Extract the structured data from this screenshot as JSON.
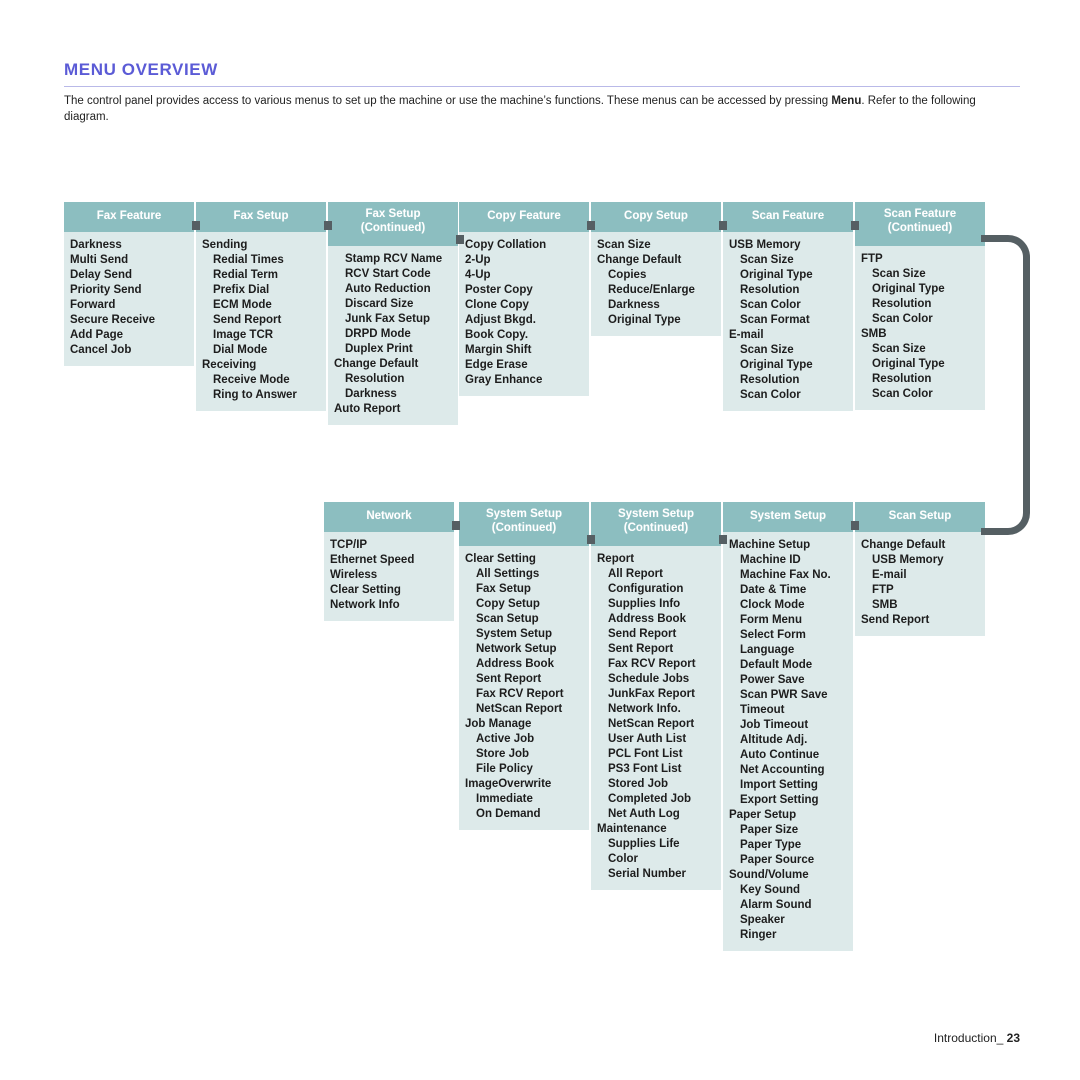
{
  "header": {
    "title": "MENU OVERVIEW",
    "intro_part1": "The control panel provides access to various menus to set up the machine or use the machine’s functions. These menus can be accessed by pressing ",
    "intro_bold": "Menu",
    "intro_part2": ". Refer to the following diagram."
  },
  "colors": {
    "title": "#5b5bd6",
    "node_header_bg": "#8cbec0",
    "node_body_bg": "#ddeaea",
    "connector": "#555f63",
    "text": "#1d1d1d"
  },
  "footer": {
    "label": "Introduction_",
    "page": "23"
  },
  "diagram": {
    "row1": [
      {
        "title": "Fax Feature",
        "subtitle": "",
        "align": "left",
        "items": [
          {
            "label": "Darkness",
            "level": 1
          },
          {
            "label": "Multi Send",
            "level": 1
          },
          {
            "label": "Delay Send",
            "level": 1
          },
          {
            "label": "Priority Send",
            "level": 1
          },
          {
            "label": "Forward",
            "level": 1
          },
          {
            "label": "Secure Receive",
            "level": 1
          },
          {
            "label": "Add Page",
            "level": 1
          },
          {
            "label": "Cancel Job",
            "level": 1
          }
        ]
      },
      {
        "title": "Fax Setup",
        "subtitle": "",
        "align": "left",
        "items": [
          {
            "label": "Sending",
            "level": 1
          },
          {
            "label": "Redial Times",
            "level": 2
          },
          {
            "label": "Redial Term",
            "level": 2
          },
          {
            "label": "Prefix Dial",
            "level": 2
          },
          {
            "label": "ECM Mode",
            "level": 2
          },
          {
            "label": "Send Report",
            "level": 2
          },
          {
            "label": "Image TCR",
            "level": 2
          },
          {
            "label": "Dial Mode",
            "level": 2
          },
          {
            "label": "Receiving",
            "level": 1
          },
          {
            "label": "Receive Mode",
            "level": 2
          },
          {
            "label": "Ring to Answer",
            "level": 2
          }
        ]
      },
      {
        "title": "Fax Setup",
        "subtitle": "(Continued)",
        "align": "right",
        "items": [
          {
            "label": "Stamp RCV Name",
            "level": 2
          },
          {
            "label": "RCV Start Code",
            "level": 2
          },
          {
            "label": "Auto Reduction",
            "level": 2
          },
          {
            "label": "Discard Size",
            "level": 2
          },
          {
            "label": "Junk Fax Setup",
            "level": 2
          },
          {
            "label": "DRPD Mode",
            "level": 2
          },
          {
            "label": "Duplex Print",
            "level": 2
          },
          {
            "label": "Change Default",
            "level": 1
          },
          {
            "label": "Resolution",
            "level": 2
          },
          {
            "label": "Darkness",
            "level": 2
          },
          {
            "label": "Auto Report",
            "level": 1
          }
        ]
      },
      {
        "title": "Copy Feature",
        "subtitle": "",
        "align": "left",
        "items": [
          {
            "label": "Copy Collation",
            "level": 1
          },
          {
            "label": "2-Up",
            "level": 1
          },
          {
            "label": "4-Up",
            "level": 1
          },
          {
            "label": "Poster Copy",
            "level": 1
          },
          {
            "label": "Clone Copy",
            "level": 1
          },
          {
            "label": "Adjust Bkgd.",
            "level": 1
          },
          {
            "label": "Book Copy.",
            "level": 1
          },
          {
            "label": "Margin Shift",
            "level": 1
          },
          {
            "label": "Edge Erase",
            "level": 1
          },
          {
            "label": "Gray Enhance",
            "level": 1
          }
        ]
      },
      {
        "title": "Copy Setup",
        "subtitle": "",
        "align": "left",
        "items": [
          {
            "label": "Scan Size",
            "level": 1
          },
          {
            "label": "Change Default",
            "level": 1
          },
          {
            "label": "Copies",
            "level": 2
          },
          {
            "label": "Reduce/Enlarge",
            "level": 2
          },
          {
            "label": "Darkness",
            "level": 2
          },
          {
            "label": "Original Type",
            "level": 2
          }
        ]
      },
      {
        "title": "Scan Feature",
        "subtitle": "",
        "align": "left",
        "items": [
          {
            "label": "USB Memory",
            "level": 1
          },
          {
            "label": "Scan Size",
            "level": 2
          },
          {
            "label": "Original Type",
            "level": 2
          },
          {
            "label": "Resolution",
            "level": 2
          },
          {
            "label": "Scan Color",
            "level": 2
          },
          {
            "label": "Scan Format",
            "level": 2
          },
          {
            "label": "E-mail",
            "level": 1
          },
          {
            "label": "Scan Size",
            "level": 2
          },
          {
            "label": "Original Type",
            "level": 2
          },
          {
            "label": "Resolution",
            "level": 2
          },
          {
            "label": "Scan Color",
            "level": 2
          }
        ]
      },
      {
        "title": "Scan Feature",
        "subtitle": "(Continued)",
        "align": "left",
        "items": [
          {
            "label": "FTP",
            "level": 1
          },
          {
            "label": "Scan Size",
            "level": 2
          },
          {
            "label": "Original Type",
            "level": 2
          },
          {
            "label": "Resolution",
            "level": 2
          },
          {
            "label": "Scan Color",
            "level": 2
          },
          {
            "label": "SMB",
            "level": 1
          },
          {
            "label": "Scan Size",
            "level": 2
          },
          {
            "label": "Original Type",
            "level": 2
          },
          {
            "label": "Resolution",
            "level": 2
          },
          {
            "label": "Scan Color",
            "level": 2
          }
        ]
      }
    ],
    "row2": [
      {
        "title": "Network",
        "subtitle": "",
        "align": "left",
        "items": [
          {
            "label": "TCP/IP",
            "level": 1
          },
          {
            "label": "Ethernet Speed",
            "level": 1
          },
          {
            "label": "Wireless",
            "level": 1
          },
          {
            "label": "Clear Setting",
            "level": 1
          },
          {
            "label": "Network Info",
            "level": 1
          }
        ]
      },
      {
        "title": "System Setup",
        "subtitle": "(Continued)",
        "align": "left",
        "items": [
          {
            "label": "Clear Setting",
            "level": 1
          },
          {
            "label": "All Settings",
            "level": 2
          },
          {
            "label": "Fax Setup",
            "level": 2
          },
          {
            "label": "Copy Setup",
            "level": 2
          },
          {
            "label": "Scan Setup",
            "level": 2
          },
          {
            "label": "System Setup",
            "level": 2
          },
          {
            "label": "Network Setup",
            "level": 2
          },
          {
            "label": "Address Book",
            "level": 2
          },
          {
            "label": "Sent Report",
            "level": 2
          },
          {
            "label": "Fax RCV Report",
            "level": 2
          },
          {
            "label": "NetScan Report",
            "level": 2
          },
          {
            "label": "Job Manage",
            "level": 1
          },
          {
            "label": "Active Job",
            "level": 2
          },
          {
            "label": "Store Job",
            "level": 2
          },
          {
            "label": "File Policy",
            "level": 2
          },
          {
            "label": "ImageOverwrite",
            "level": 1
          },
          {
            "label": "Immediate",
            "level": 2
          },
          {
            "label": "On Demand",
            "level": 2
          }
        ]
      },
      {
        "title": "System Setup",
        "subtitle": "(Continued)",
        "align": "left",
        "items": [
          {
            "label": "Report",
            "level": 1
          },
          {
            "label": "All Report",
            "level": 2
          },
          {
            "label": "Configuration",
            "level": 2
          },
          {
            "label": "Supplies Info",
            "level": 2
          },
          {
            "label": "Address Book",
            "level": 2
          },
          {
            "label": "Send Report",
            "level": 2
          },
          {
            "label": "Sent Report",
            "level": 2
          },
          {
            "label": "Fax RCV Report",
            "level": 2
          },
          {
            "label": "Schedule Jobs",
            "level": 2
          },
          {
            "label": "JunkFax Report",
            "level": 2
          },
          {
            "label": "Network Info.",
            "level": 2
          },
          {
            "label": "NetScan Report",
            "level": 2
          },
          {
            "label": "User Auth List",
            "level": 2
          },
          {
            "label": "PCL Font List",
            "level": 2
          },
          {
            "label": "PS3 Font List",
            "level": 2
          },
          {
            "label": "Stored Job",
            "level": 2
          },
          {
            "label": "Completed Job",
            "level": 2
          },
          {
            "label": "Net Auth Log",
            "level": 2
          },
          {
            "label": "Maintenance",
            "level": 1
          },
          {
            "label": "Supplies Life",
            "level": 2
          },
          {
            "label": "Color",
            "level": 2
          },
          {
            "label": "Serial Number",
            "level": 2
          }
        ]
      },
      {
        "title": "System Setup",
        "subtitle": "",
        "align": "left",
        "items": [
          {
            "label": "Machine Setup",
            "level": 1
          },
          {
            "label": "Machine ID",
            "level": 2
          },
          {
            "label": "Machine Fax No.",
            "level": 2
          },
          {
            "label": "Date & Time",
            "level": 2
          },
          {
            "label": "Clock Mode",
            "level": 2
          },
          {
            "label": "Form Menu",
            "level": 2
          },
          {
            "label": "Select Form",
            "level": 2
          },
          {
            "label": "Language",
            "level": 2
          },
          {
            "label": "Default Mode",
            "level": 2
          },
          {
            "label": "Power Save",
            "level": 2
          },
          {
            "label": "Scan PWR Save",
            "level": 2
          },
          {
            "label": "Timeout",
            "level": 2
          },
          {
            "label": "Job Timeout",
            "level": 2
          },
          {
            "label": "Altitude Adj.",
            "level": 2
          },
          {
            "label": "Auto Continue",
            "level": 2
          },
          {
            "label": "Net Accounting",
            "level": 2
          },
          {
            "label": "Import Setting",
            "level": 2
          },
          {
            "label": "Export Setting",
            "level": 2
          },
          {
            "label": "Paper Setup",
            "level": 1
          },
          {
            "label": "Paper Size",
            "level": 2
          },
          {
            "label": "Paper Type",
            "level": 2
          },
          {
            "label": "Paper Source",
            "level": 2
          },
          {
            "label": "Sound/Volume",
            "level": 1
          },
          {
            "label": "Key Sound",
            "level": 2
          },
          {
            "label": "Alarm Sound",
            "level": 2
          },
          {
            "label": "Speaker",
            "level": 2
          },
          {
            "label": "Ringer",
            "level": 2
          }
        ]
      },
      {
        "title": "Scan Setup",
        "subtitle": "",
        "align": "left",
        "items": [
          {
            "label": "Change Default",
            "level": 1
          },
          {
            "label": "USB Memory",
            "level": 2
          },
          {
            "label": "E-mail",
            "level": 2
          },
          {
            "label": "FTP",
            "level": 2
          },
          {
            "label": "SMB",
            "level": 2
          },
          {
            "label": "Send Report",
            "level": 1
          }
        ]
      }
    ]
  }
}
